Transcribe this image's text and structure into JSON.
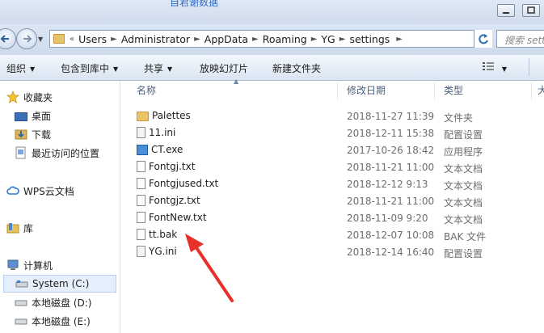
{
  "window": {
    "title": "自君谢数据"
  },
  "address": {
    "crumbs": [
      "Users",
      "Administrator",
      "AppData",
      "Roaming",
      "YG",
      "settings"
    ],
    "search_placeholder": "搜索 setti"
  },
  "toolbar": {
    "organize": "组织",
    "include_in_library": "包含到库中",
    "share": "共享",
    "slideshow": "放映幻灯片",
    "new_folder": "新建文件夹"
  },
  "sidebar": {
    "favorites": "收藏夹",
    "desktop": "桌面",
    "downloads": "下载",
    "recent": "最近访问的位置",
    "wps": "WPS云文档",
    "library": "库",
    "computer": "计算机",
    "system_c": "System (C:)",
    "local_d": "本地磁盘 (D:)",
    "local_e": "本地磁盘 (E:)"
  },
  "columns": {
    "name": "名称",
    "date": "修改日期",
    "type": "类型",
    "size": "大"
  },
  "files": [
    {
      "name": "Palettes",
      "date": "2018-11-27 11:39",
      "type": "文件夹",
      "icon": "folder-icon"
    },
    {
      "name": "11.ini",
      "date": "2018-12-11 15:38",
      "type": "配置设置",
      "icon": "ini-file-icon"
    },
    {
      "name": "CT.exe",
      "date": "2017-10-26 18:42",
      "type": "应用程序",
      "icon": "exe-file-icon"
    },
    {
      "name": "Fontgj.txt",
      "date": "2018-11-21 11:00",
      "type": "文本文档",
      "icon": "text-file-icon"
    },
    {
      "name": "Fontgjused.txt",
      "date": "2018-12-12 9:13",
      "type": "文本文档",
      "icon": "text-file-icon"
    },
    {
      "name": "Fontgjz.txt",
      "date": "2018-11-21 11:00",
      "type": "文本文档",
      "icon": "text-file-icon"
    },
    {
      "name": "FontNew.txt",
      "date": "2018-11-09 9:20",
      "type": "文本文档",
      "icon": "text-file-icon"
    },
    {
      "name": "tt.bak",
      "date": "2018-12-07 10:08",
      "type": "BAK 文件",
      "icon": "blank-file-icon"
    },
    {
      "name": "YG.ini",
      "date": "2018-12-14 16:40",
      "type": "配置设置",
      "icon": "ini-file-icon"
    }
  ],
  "annotation": {
    "arrow_color": "#e8302a"
  }
}
